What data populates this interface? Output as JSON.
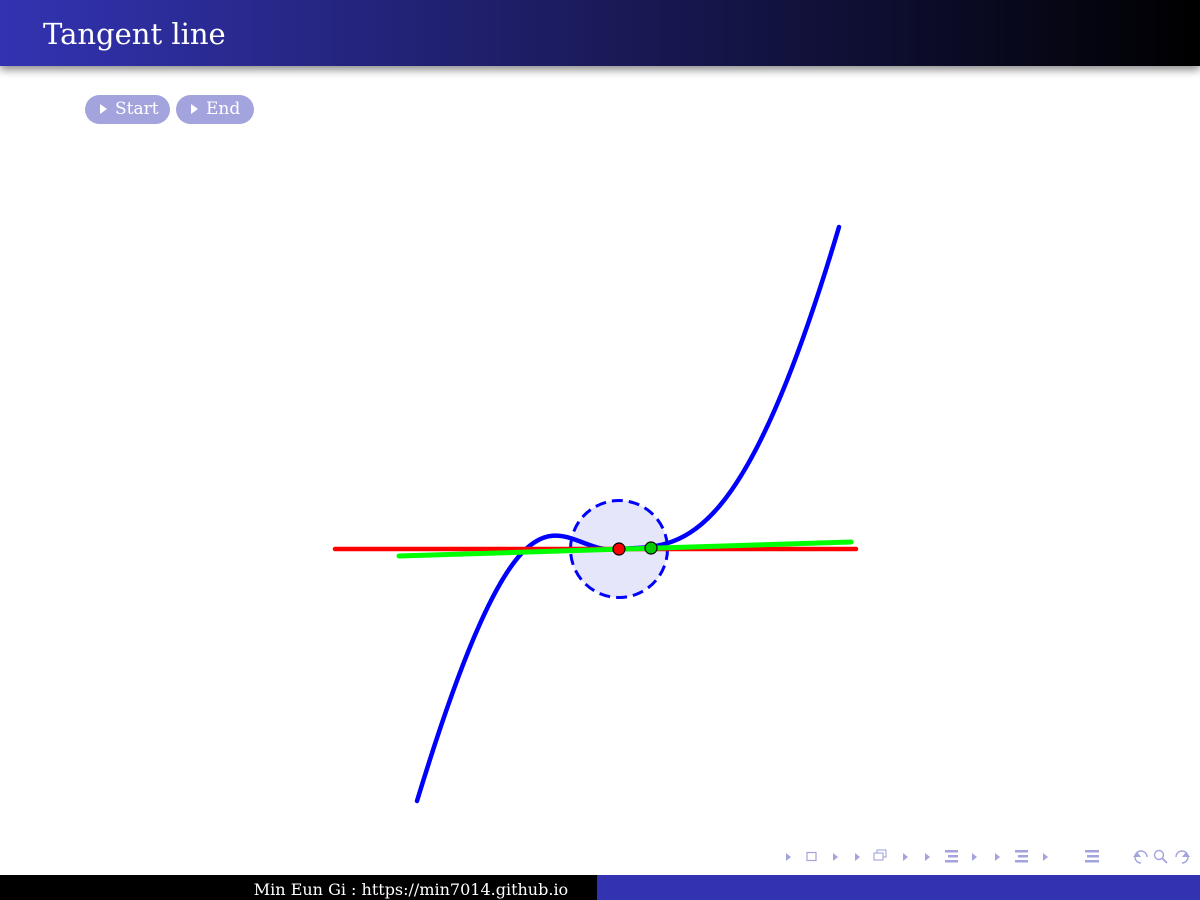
{
  "slide": {
    "title": "Tangent line"
  },
  "buttons": {
    "start_label": "Start",
    "end_label": "End"
  },
  "footer": {
    "author": "Min Eun Gi : https://min7014.github.io"
  },
  "colors": {
    "title_gradient_start": "#3333b2",
    "title_gradient_end": "#000000",
    "button_bg": "#a3a3dd",
    "curve": "#0000ff",
    "tangent_line": "#ff0000",
    "secant_line": "#00ff00",
    "tangent_point": "#ff0000",
    "moving_point": "#00cc00",
    "circle_fill": "#e6e6fa",
    "circle_stroke": "#0000ff",
    "footer_left": "#000000",
    "footer_right": "#3333b2",
    "nav_icons": "#a3a3dd"
  },
  "navigation_icons": [
    "nav-frame-left-icon",
    "nav-frame-icon",
    "nav-frame-right-icon",
    "nav-subsection-left-icon",
    "nav-subsection-icon",
    "nav-subsection-right-icon",
    "nav-section-left-icon",
    "nav-section-icon",
    "nav-section-right-icon",
    "nav-appendix-left-icon",
    "nav-appendix-icon",
    "nav-appendix-right-icon",
    "nav-doc-icon",
    "nav-back-icon",
    "nav-search-icon",
    "nav-forward-icon"
  ]
}
